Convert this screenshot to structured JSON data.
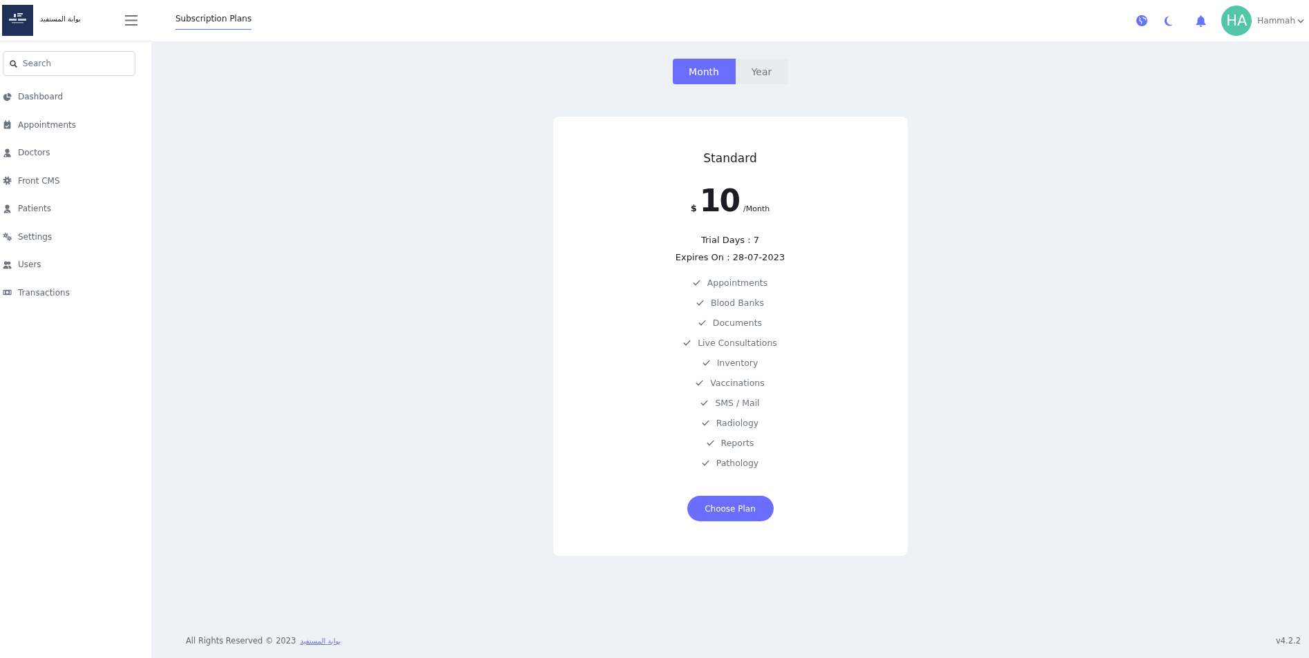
{
  "brand": {
    "name": "بوابة المستفيد"
  },
  "header": {
    "tabs": [
      {
        "label": "Subscription Plans",
        "selected": true
      }
    ],
    "user": {
      "initials": "HA",
      "name": "Hammah"
    }
  },
  "sidebar": {
    "search": {
      "placeholder": "Search"
    },
    "items": [
      {
        "label": "Dashboard"
      },
      {
        "label": "Appointments"
      },
      {
        "label": "Doctors"
      },
      {
        "label": "Front CMS"
      },
      {
        "label": "Patients"
      },
      {
        "label": "Settings"
      },
      {
        "label": "Users"
      },
      {
        "label": "Transactions"
      }
    ]
  },
  "billing_toggle": [
    {
      "label": "Month",
      "selected": true
    },
    {
      "label": "Year",
      "selected": false
    }
  ],
  "plan": {
    "name": "Standard",
    "currency": "$",
    "price": "10",
    "period": "/Month",
    "trial": "Trial Days : 7",
    "expires": "Expires On : 28-07-2023",
    "features": [
      "Appointments",
      "Blood Banks",
      "Documents",
      "Live Consultations",
      "Inventory",
      "Vaccinations",
      "SMS / Mail",
      "Radiology",
      "Reports",
      "Pathology"
    ],
    "button": "Choose Plan"
  },
  "footer": {
    "copyright": "All Rights Reserved © 2023",
    "link": "بوابة المستفيد",
    "version": "v4.2.2"
  }
}
